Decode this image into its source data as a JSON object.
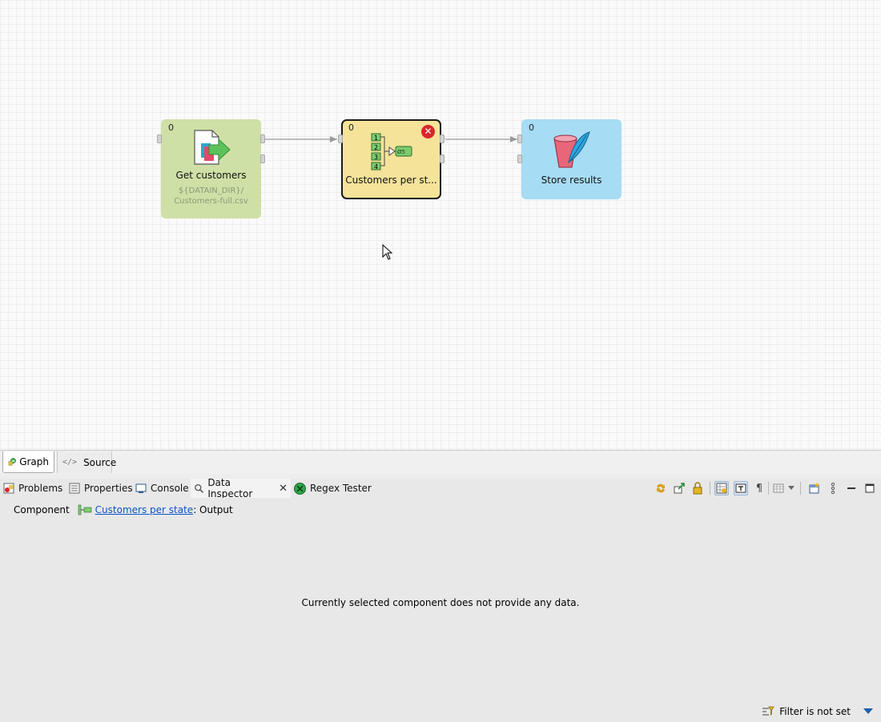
{
  "canvas": {
    "nodes": [
      {
        "id": "get-customers",
        "count": "0",
        "label": "Get customers",
        "sub_lines": [
          "${DATAIN_DIR}/",
          "Customers-full.csv"
        ],
        "color": "#cee0a6",
        "status": "ok"
      },
      {
        "id": "customers-per-state",
        "count": "0",
        "label": "Customers per st...",
        "color": "#f5e39a",
        "status": "error",
        "selected": true
      },
      {
        "id": "store-results",
        "count": "0",
        "label": "Store results",
        "color": "#a7dcf5",
        "status": "ok"
      }
    ]
  },
  "editor_tabs": [
    {
      "label": "Graph",
      "icon": "graph-icon",
      "active": true
    },
    {
      "label": "Source",
      "icon": "source-code-icon",
      "active": false
    }
  ],
  "view_tabs": [
    {
      "label": "Problems",
      "icon": "problems-icon"
    },
    {
      "label": "Properties",
      "icon": "properties-icon"
    },
    {
      "label": "Console",
      "icon": "console-icon"
    },
    {
      "label": "Data Inspector",
      "icon": "magnifier-icon",
      "active": true,
      "closable": true
    },
    {
      "label": "Regex Tester",
      "icon": "regex-tester-icon"
    }
  ],
  "inspector": {
    "component_label": "Component",
    "component_link": "Customers per state",
    "component_suffix": ": Output",
    "empty_message": "Currently selected component does not provide any data.",
    "filter_label": "Filter is not set"
  },
  "colors": {
    "link": "#0a55c8",
    "error": "#d9262b",
    "reader_node": "#cee0a6",
    "transform_node": "#f5e39a",
    "writer_node": "#a7dcf5"
  }
}
